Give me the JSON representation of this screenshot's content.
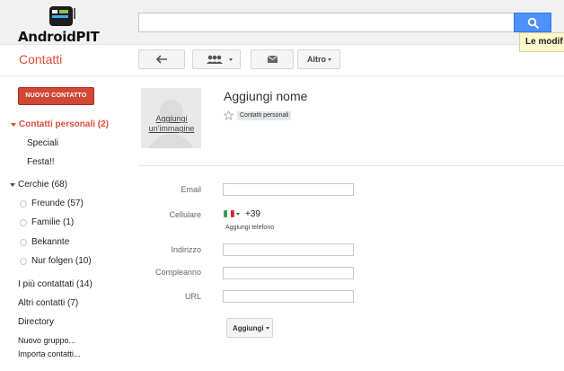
{
  "header": {
    "brand": "AndroidPIT",
    "search_placeholder": "",
    "tooltip": "Le modif"
  },
  "toolbar": {
    "app_title": "Contatti",
    "more_label": "Altro"
  },
  "sidebar": {
    "new_contact_label": "NUOVO CONTATTO",
    "personal_contacts": "Contatti personali (2)",
    "sub_items": [
      "Speciali",
      "Festa!!"
    ],
    "circles": "Cerchie (68)",
    "circle_items": [
      "Freunde (57)",
      "Familie (1)",
      "Bekannte",
      "Nur folgen (10)"
    ],
    "other_items": [
      "I più contattati (14)",
      "Altri contatti (7)",
      "Directory",
      "Nuovo gruppo...",
      "Importa contatti..."
    ]
  },
  "contact": {
    "avatar_link": "Aggiungi un'immagine",
    "name_placeholder": "Aggiungi nome",
    "group_tag": "Contatti personali"
  },
  "form": {
    "email_label": "Email",
    "phone_label": "Cellulare",
    "phone_code": "+39",
    "add_phone": "Aggiungi telefono",
    "address_label": "Indirizzo",
    "birthday_label": "Compleanno",
    "url_label": "URL",
    "add_button": "Aggiungi"
  }
}
